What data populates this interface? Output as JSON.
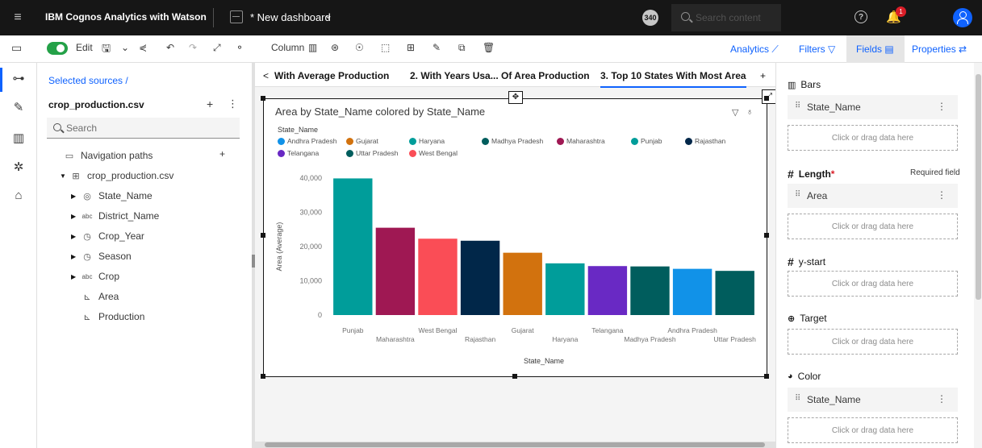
{
  "topbar": {
    "brand": "IBM Cognos Analytics with Watson",
    "dashboard_name": "* New dashboard",
    "notifications_count": "340",
    "search_placeholder": "Search content",
    "bell_badge": "1"
  },
  "toolbar": {
    "edit_label": "Edit",
    "viz_label": "Column",
    "analytics": "Analytics",
    "filters": "Filters",
    "fields": "Fields",
    "properties": "Properties"
  },
  "sources": {
    "breadcrumb": "Selected sources  /",
    "file": "crop_production.csv",
    "search_placeholder": "Search",
    "navigation_paths": "Navigation paths",
    "table": "crop_production.csv",
    "columns": [
      "State_Name",
      "District_Name",
      "Crop_Year",
      "Season",
      "Crop",
      "Area",
      "Production"
    ]
  },
  "tabs": {
    "tab1": "With Average Productions",
    "tab2": "2.  With Years Usa... Of Area Production",
    "tab3": "3.  Top 10 States With Most Area",
    "add": "+"
  },
  "widget": {
    "title": "Area by State_Name colored by State_Name",
    "legend_title": "State_Name"
  },
  "chart_data": {
    "type": "bar",
    "title": "Area by State_Name colored by State_Name",
    "xlabel": "State_Name",
    "ylabel": "Area (Average)",
    "ylim": [
      0,
      40000
    ],
    "yticks": [
      "40,000",
      "30,000",
      "20,000",
      "10,000",
      "0"
    ],
    "grid": false,
    "legend_placement": "top-left",
    "categories": [
      "Punjab",
      "Maharashtra",
      "West Bengal",
      "Rajasthan",
      "Gujarat",
      "Haryana",
      "Telangana",
      "Madhya Pradesh",
      "Andhra Pradesh",
      "Uttar Pradesh"
    ],
    "values": [
      39900,
      25500,
      22300,
      21700,
      18200,
      15100,
      14300,
      14200,
      13500,
      12900
    ],
    "colors": [
      "#009d9a",
      "#9f1853",
      "#fa4d56",
      "#012749",
      "#d2720e",
      "#009d9a",
      "#6929c4",
      "#005d5d",
      "#1192e8",
      "#005d5d"
    ],
    "legend": [
      {
        "name": "Andhra Pradesh",
        "color": "#1192e8"
      },
      {
        "name": "Gujarat",
        "color": "#d2720e"
      },
      {
        "name": "Haryana",
        "color": "#009d9a"
      },
      {
        "name": "Madhya Pradesh",
        "color": "#005d5d"
      },
      {
        "name": "Maharashtra",
        "color": "#9f1853"
      },
      {
        "name": "Punjab",
        "color": "#009d9a"
      },
      {
        "name": "Rajasthan",
        "color": "#012749"
      },
      {
        "name": "Telangana",
        "color": "#6929c4"
      },
      {
        "name": "Uttar Pradesh",
        "color": "#005d5d"
      },
      {
        "name": "West Bengal",
        "color": "#fa4d56"
      }
    ]
  },
  "fields_panel": {
    "bars": "Bars",
    "bars_field": "State_Name",
    "drop_hint": "Click or drag data here",
    "length": "Length",
    "length_req_mark": "*",
    "required": "Required field",
    "length_field": "Area",
    "ystart": "y-start",
    "target": "Target",
    "color": "Color",
    "color_field": "State_Name"
  }
}
